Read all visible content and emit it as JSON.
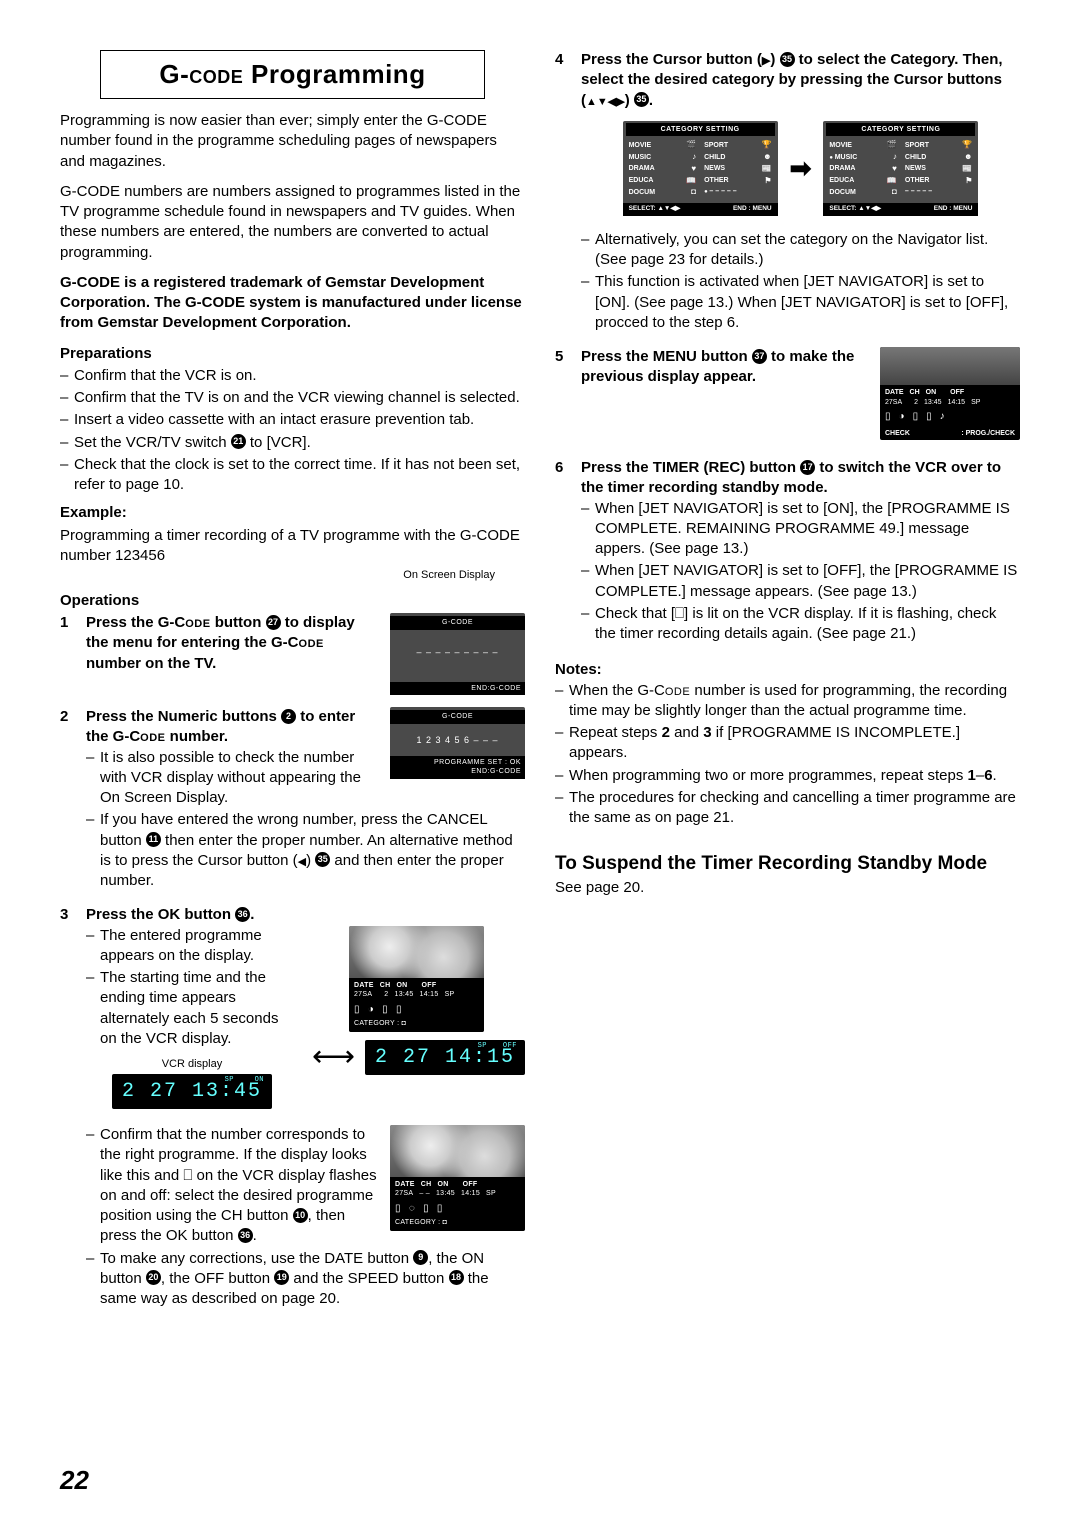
{
  "title": "G-CODE Programming",
  "intro1": "Programming is now easier than ever; simply enter the G-CODE number found in the programme scheduling pages of newspapers and magazines.",
  "intro2": "G-CODE numbers are numbers assigned to programmes listed in the TV programme schedule found in newspapers and TV guides. When these numbers are entered, the numbers are converted to actual programming.",
  "trademark": "G-CODE is a registered trademark of Gemstar Development Corporation. The G-CODE system is manufactured under license from Gemstar Development Corporation.",
  "prep_head": "Preparations",
  "prep": [
    "Confirm that the VCR is on.",
    "Confirm that the TV is on and the VCR viewing channel is selected.",
    "Insert a video cassette with an intact erasure prevention tab.",
    "Set the VCR/TV switch ㉑ to [VCR].",
    "Check that the clock is set to the correct time. If it has not been set, refer to page 10."
  ],
  "example_head": "Example:",
  "example_text": "Programming a timer recording of a TV programme with the G-CODE number 123456",
  "osd_label": "On Screen Display",
  "ops_head": "Operations",
  "step1": {
    "lead": "Press the G-CODE button ㉗ to display the menu for entering the G-CODE number on the TV.",
    "osd_title": "G-CODE",
    "osd_mid": "– – – – – – – – –",
    "osd_end": "END:G-CODE"
  },
  "step2": {
    "lead": "Press the Numeric buttons ❷ to enter the G-CODE number.",
    "sub": [
      "It is also possible to check the number with VCR display without appearing the On Screen Display.",
      "If you have entered the wrong number, press the CANCEL button ⓫ then enter the proper number. An alternative method is to press the Cursor button (◀) ㉟ and then enter the proper number."
    ],
    "osd_title": "G-CODE",
    "osd_mid": "1 2 3 4 5 6 – – –",
    "osd_foot1": "PROGRAMME  SET : OK",
    "osd_foot2": "END:G-CODE"
  },
  "step3": {
    "lead": "Press the OK button ㊱.",
    "sub": [
      "The entered programme appears on the display.",
      "The starting time and the ending time appears alternately each 5 seconds on the VCR display.",
      "Confirm that the number corresponds to the right programme. If the display looks like this and ⎕ on the VCR display flashes on and off: select the desired programme position using the CH button ❿, then press the OK button ㊱.",
      "To make any corrections, use the DATE button ❾, the ON button ⓴, the OFF button ⓳ and the SPEED button ⓮ the same way as described on page 20."
    ],
    "vcr_label": "VCR display",
    "vcr1": "2  27 13:45",
    "vcr1_sp": "SP",
    "vcr1_on": "ON",
    "vcr2": "2  27 14:15",
    "vcr2_sp": "SP",
    "vcr2_off": "OFF",
    "photo1": {
      "h": [
        "DATE",
        "CH",
        "ON",
        "OFF",
        ""
      ],
      "v": [
        "27SA",
        "2",
        "13:45",
        "14:15",
        "SP"
      ],
      "cat": "CATEGORY : ◘"
    },
    "photo2": {
      "h": [
        "DATE",
        "CH",
        "ON",
        "OFF",
        ""
      ],
      "v": [
        "27SA",
        "– –",
        "13:45",
        "14:15",
        "SP"
      ],
      "cat": "CATEGORY : ◘"
    }
  },
  "step4": {
    "lead": "Press the Cursor button (▶) ㉟ to select the Category. Then, select the desired category by pressing the Cursor buttons (▲▼◀▶) ㉟.",
    "cat_title": "CATEGORY SETTING",
    "left_col": [
      [
        "MOVIE",
        "🎬"
      ],
      [
        "MUSIC",
        "♪"
      ],
      [
        "DRAMA",
        "♥"
      ],
      [
        "EDUCA",
        "📖"
      ],
      [
        "DOCUM",
        "◘"
      ]
    ],
    "right_col": [
      [
        "SPORT",
        "🏆"
      ],
      [
        "CHILD",
        "☻"
      ],
      [
        "NEWS",
        "📰"
      ],
      [
        "OTHER",
        "⚑"
      ],
      [
        "– – – – –",
        ""
      ]
    ],
    "ftr_l": "SELECT: ▲▼◀▶",
    "ftr_r": "END : MENU",
    "sub": [
      "Alternatively, you can set the category on the Navigator list. (See page 23 for details.)",
      "This function is activated when [JET NAVIGATOR] is set to [ON]. (See page 13.) When [JET NAVIGATOR] is set to [OFF], procced to the step 6."
    ]
  },
  "step5": {
    "lead": "Press the MENU button ㊲ to make the previous display appear.",
    "check": {
      "h": [
        "DATE",
        "CH",
        "ON",
        "OFF",
        ""
      ],
      "v": [
        "27SA",
        "2",
        "13:45",
        "14:15",
        "SP"
      ],
      "ftr_l": "CHECK",
      "ftr_r": ": PROG./CHECK"
    }
  },
  "step6": {
    "lead": "Press the TIMER (REC) button ⓱ to switch the VCR over to the timer recording standby mode.",
    "sub": [
      "When [JET NAVIGATOR] is set to [ON], the [PROGRAMME IS COMPLETE. REMAINING PROGRAMME 49.] message appers. (See page 13.)",
      "When [JET NAVIGATOR] is set to [OFF], the [PROGRAMME IS COMPLETE.] message appears. (See page 13.)",
      "Check that [⎕] is lit on the VCR display. If it is flashing, check the timer recording details again. (See page 21.)"
    ]
  },
  "notes_head": "Notes:",
  "notes": [
    "When the G-CODE number is used for programming, the recording time may be slightly longer than the actual programme time.",
    "Repeat steps 2 and 3 if [PROGRAMME IS INCOMPLETE.] appears.",
    "When programming two or more programmes, repeat steps 1–6.",
    "The procedures for checking and cancelling a timer programme are the same as on page 21."
  ],
  "suspend_head": "To Suspend the Timer Recording Standby Mode",
  "suspend_text": "See page 20.",
  "page_number": "22"
}
